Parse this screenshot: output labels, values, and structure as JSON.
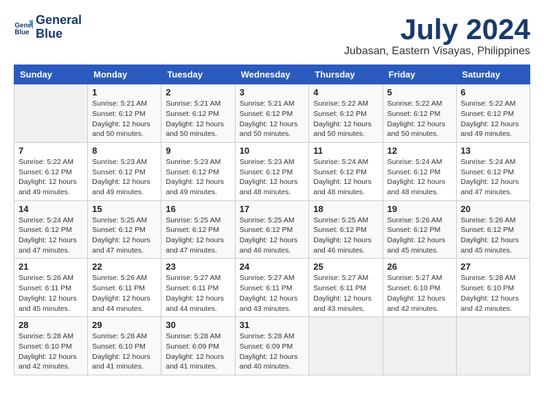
{
  "header": {
    "logo_line1": "General",
    "logo_line2": "Blue",
    "month_year": "July 2024",
    "location": "Jubasan, Eastern Visayas, Philippines"
  },
  "weekdays": [
    "Sunday",
    "Monday",
    "Tuesday",
    "Wednesday",
    "Thursday",
    "Friday",
    "Saturday"
  ],
  "weeks": [
    [
      {
        "day": "",
        "info": ""
      },
      {
        "day": "1",
        "info": "Sunrise: 5:21 AM\nSunset: 6:12 PM\nDaylight: 12 hours and 50 minutes."
      },
      {
        "day": "2",
        "info": "Sunrise: 5:21 AM\nSunset: 6:12 PM\nDaylight: 12 hours and 50 minutes."
      },
      {
        "day": "3",
        "info": "Sunrise: 5:21 AM\nSunset: 6:12 PM\nDaylight: 12 hours and 50 minutes."
      },
      {
        "day": "4",
        "info": "Sunrise: 5:22 AM\nSunset: 6:12 PM\nDaylight: 12 hours and 50 minutes."
      },
      {
        "day": "5",
        "info": "Sunrise: 5:22 AM\nSunset: 6:12 PM\nDaylight: 12 hours and 50 minutes."
      },
      {
        "day": "6",
        "info": "Sunrise: 5:22 AM\nSunset: 6:12 PM\nDaylight: 12 hours and 49 minutes."
      }
    ],
    [
      {
        "day": "7",
        "info": "Sunrise: 5:22 AM\nSunset: 6:12 PM\nDaylight: 12 hours and 49 minutes."
      },
      {
        "day": "8",
        "info": "Sunrise: 5:23 AM\nSunset: 6:12 PM\nDaylight: 12 hours and 49 minutes."
      },
      {
        "day": "9",
        "info": "Sunrise: 5:23 AM\nSunset: 6:12 PM\nDaylight: 12 hours and 49 minutes."
      },
      {
        "day": "10",
        "info": "Sunrise: 5:23 AM\nSunset: 6:12 PM\nDaylight: 12 hours and 48 minutes."
      },
      {
        "day": "11",
        "info": "Sunrise: 5:24 AM\nSunset: 6:12 PM\nDaylight: 12 hours and 48 minutes."
      },
      {
        "day": "12",
        "info": "Sunrise: 5:24 AM\nSunset: 6:12 PM\nDaylight: 12 hours and 48 minutes."
      },
      {
        "day": "13",
        "info": "Sunrise: 5:24 AM\nSunset: 6:12 PM\nDaylight: 12 hours and 47 minutes."
      }
    ],
    [
      {
        "day": "14",
        "info": "Sunrise: 5:24 AM\nSunset: 6:12 PM\nDaylight: 12 hours and 47 minutes."
      },
      {
        "day": "15",
        "info": "Sunrise: 5:25 AM\nSunset: 6:12 PM\nDaylight: 12 hours and 47 minutes."
      },
      {
        "day": "16",
        "info": "Sunrise: 5:25 AM\nSunset: 6:12 PM\nDaylight: 12 hours and 47 minutes."
      },
      {
        "day": "17",
        "info": "Sunrise: 5:25 AM\nSunset: 6:12 PM\nDaylight: 12 hours and 46 minutes."
      },
      {
        "day": "18",
        "info": "Sunrise: 5:25 AM\nSunset: 6:12 PM\nDaylight: 12 hours and 46 minutes."
      },
      {
        "day": "19",
        "info": "Sunrise: 5:26 AM\nSunset: 6:12 PM\nDaylight: 12 hours and 45 minutes."
      },
      {
        "day": "20",
        "info": "Sunrise: 5:26 AM\nSunset: 6:12 PM\nDaylight: 12 hours and 45 minutes."
      }
    ],
    [
      {
        "day": "21",
        "info": "Sunrise: 5:26 AM\nSunset: 6:11 PM\nDaylight: 12 hours and 45 minutes."
      },
      {
        "day": "22",
        "info": "Sunrise: 5:26 AM\nSunset: 6:11 PM\nDaylight: 12 hours and 44 minutes."
      },
      {
        "day": "23",
        "info": "Sunrise: 5:27 AM\nSunset: 6:11 PM\nDaylight: 12 hours and 44 minutes."
      },
      {
        "day": "24",
        "info": "Sunrise: 5:27 AM\nSunset: 6:11 PM\nDaylight: 12 hours and 43 minutes."
      },
      {
        "day": "25",
        "info": "Sunrise: 5:27 AM\nSunset: 6:11 PM\nDaylight: 12 hours and 43 minutes."
      },
      {
        "day": "26",
        "info": "Sunrise: 5:27 AM\nSunset: 6:10 PM\nDaylight: 12 hours and 42 minutes."
      },
      {
        "day": "27",
        "info": "Sunrise: 5:28 AM\nSunset: 6:10 PM\nDaylight: 12 hours and 42 minutes."
      }
    ],
    [
      {
        "day": "28",
        "info": "Sunrise: 5:28 AM\nSunset: 6:10 PM\nDaylight: 12 hours and 42 minutes."
      },
      {
        "day": "29",
        "info": "Sunrise: 5:28 AM\nSunset: 6:10 PM\nDaylight: 12 hours and 41 minutes."
      },
      {
        "day": "30",
        "info": "Sunrise: 5:28 AM\nSunset: 6:09 PM\nDaylight: 12 hours and 41 minutes."
      },
      {
        "day": "31",
        "info": "Sunrise: 5:28 AM\nSunset: 6:09 PM\nDaylight: 12 hours and 40 minutes."
      },
      {
        "day": "",
        "info": ""
      },
      {
        "day": "",
        "info": ""
      },
      {
        "day": "",
        "info": ""
      }
    ]
  ]
}
